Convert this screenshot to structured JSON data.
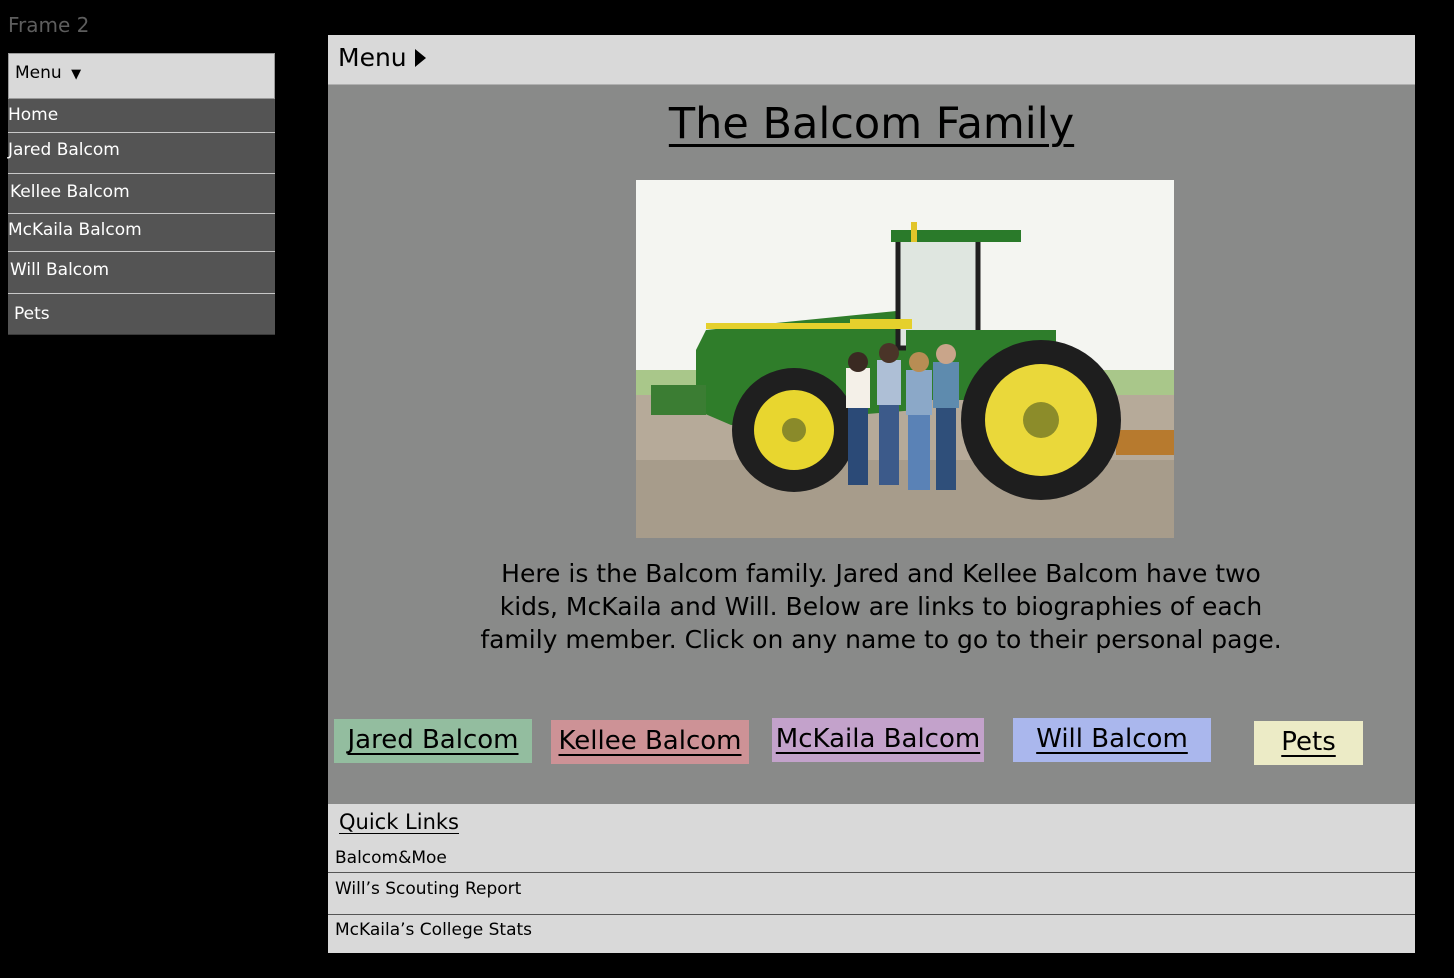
{
  "frame_label": "Frame 2",
  "side_menu": {
    "header": "Menu",
    "header_icon": "▼",
    "items": [
      {
        "label": "Home"
      },
      {
        "label": "Jared Balcom"
      },
      {
        "label": "Kellee Balcom"
      },
      {
        "label": "McKaila Balcom"
      },
      {
        "label": "Will Balcom"
      },
      {
        "label": "Pets"
      }
    ]
  },
  "page": {
    "menu_label": "Menu",
    "menu_icon": "triangle-right-icon",
    "title": "The Balcom Family",
    "photo_icon": "family-photo",
    "intro": "Here is the Balcom family. Jared and Kellee Balcom have two kids, McKaila and Will. Below are links to biographies of each family member. Click on any name to go to their personal page.",
    "name_links": [
      {
        "label": "Jared Balcom",
        "color": "#93bd9f"
      },
      {
        "label": "Kellee Balcom",
        "color": "#cd9296"
      },
      {
        "label": "McKaila Balcom",
        "color": "#c3a2cb"
      },
      {
        "label": "Will Balcom",
        "color": "#aab7ed"
      },
      {
        "label": "Pets",
        "color": "#ecebc6"
      }
    ],
    "quick_links": {
      "title": "Quick Links",
      "items": [
        {
          "label": "Balcom&Moe"
        },
        {
          "label": "Will’s Scouting Report"
        },
        {
          "label": "McKaila’s College Stats"
        }
      ]
    }
  },
  "colors": {
    "background": "#000000",
    "menu_bar": "#d9d9d9",
    "menu_item": "#545454",
    "page_body": "#898a89"
  }
}
